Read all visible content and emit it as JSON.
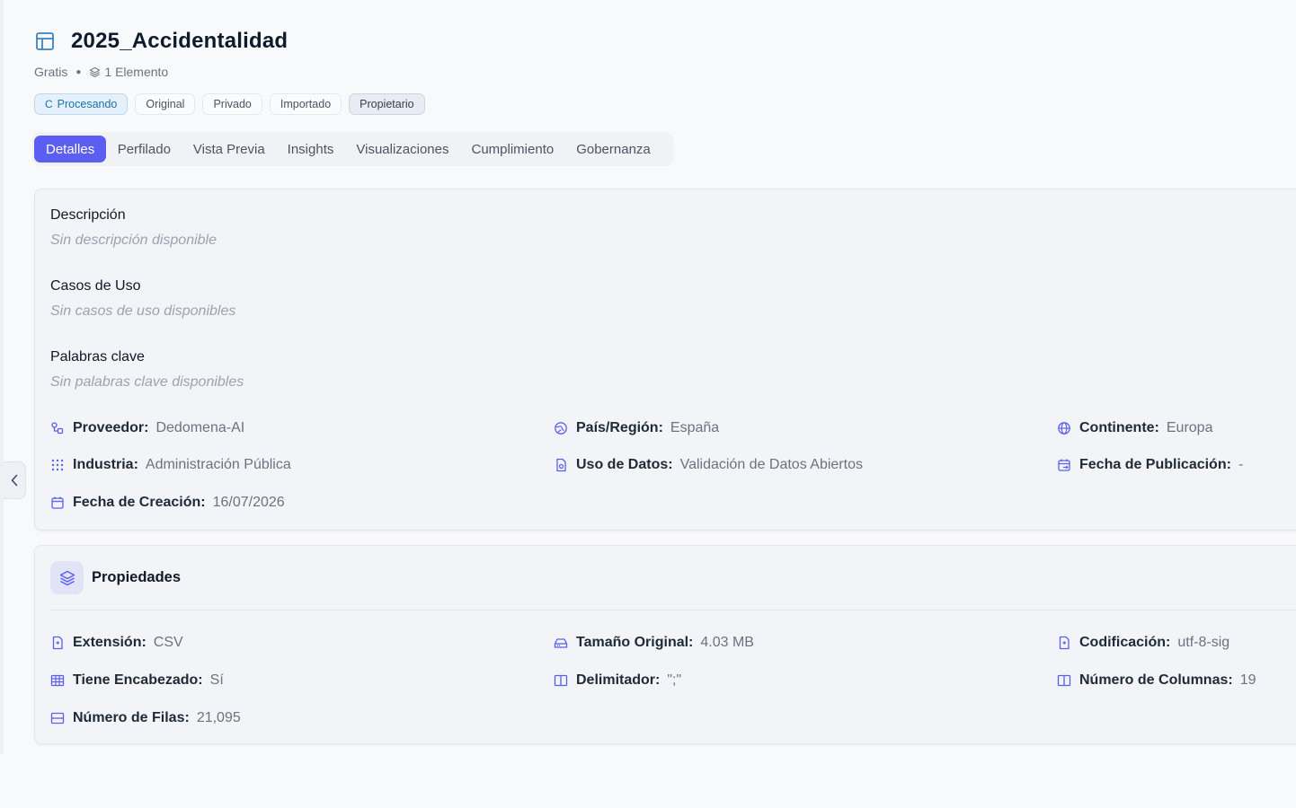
{
  "dataset": {
    "title": "2025_Accidentalidad",
    "plan": "Gratis",
    "item_count": "1 Elemento"
  },
  "badges": [
    "Procesando",
    "Original",
    "Privado",
    "Importado",
    "Propietario"
  ],
  "tabs": [
    "Detalles",
    "Perfilado",
    "Vista Previa",
    "Insights",
    "Visualizaciones",
    "Cumplimiento",
    "Gobernanza"
  ],
  "details": {
    "description": {
      "title": "Descripción",
      "empty": "Sin descripción disponible"
    },
    "use_cases": {
      "title": "Casos de Uso",
      "empty": "Sin casos de uso disponibles"
    },
    "keywords": {
      "title": "Palabras clave",
      "empty": "Sin palabras clave disponibles"
    },
    "provider": {
      "label": "Proveedor:",
      "value": "Dedomena-AI"
    },
    "country": {
      "label": "País/Región:",
      "value": "España"
    },
    "continent": {
      "label": "Continente:",
      "value": "Europa"
    },
    "industry": {
      "label": "Industria:",
      "value": "Administración Pública"
    },
    "data_use": {
      "label": "Uso de Datos:",
      "value": "Validación de Datos Abiertos"
    },
    "publication_date": {
      "label": "Fecha de Publicación:",
      "value": "-"
    },
    "creation_date": {
      "label": "Fecha de Creación:",
      "value": "16/07/2026"
    }
  },
  "properties": {
    "title": "Propiedades",
    "extension": {
      "label": "Extensión:",
      "value": "CSV"
    },
    "original_size": {
      "label": "Tamaño Original:",
      "value": "4.03 MB"
    },
    "encoding": {
      "label": "Codificación:",
      "value": "utf-8-sig"
    },
    "has_header": {
      "label": "Tiene Encabezado:",
      "value": "Sí"
    },
    "delimiter": {
      "label": "Delimitador:",
      "value": "\";\""
    },
    "column_count": {
      "label": "Número de Columnas:",
      "value": "19"
    },
    "row_count": {
      "label": "Número de Filas:",
      "value": "21,095"
    }
  },
  "colors": {
    "accent": "#5b5ef0",
    "processing": "#1e6fb0",
    "title_icon": "#3b82c4"
  }
}
